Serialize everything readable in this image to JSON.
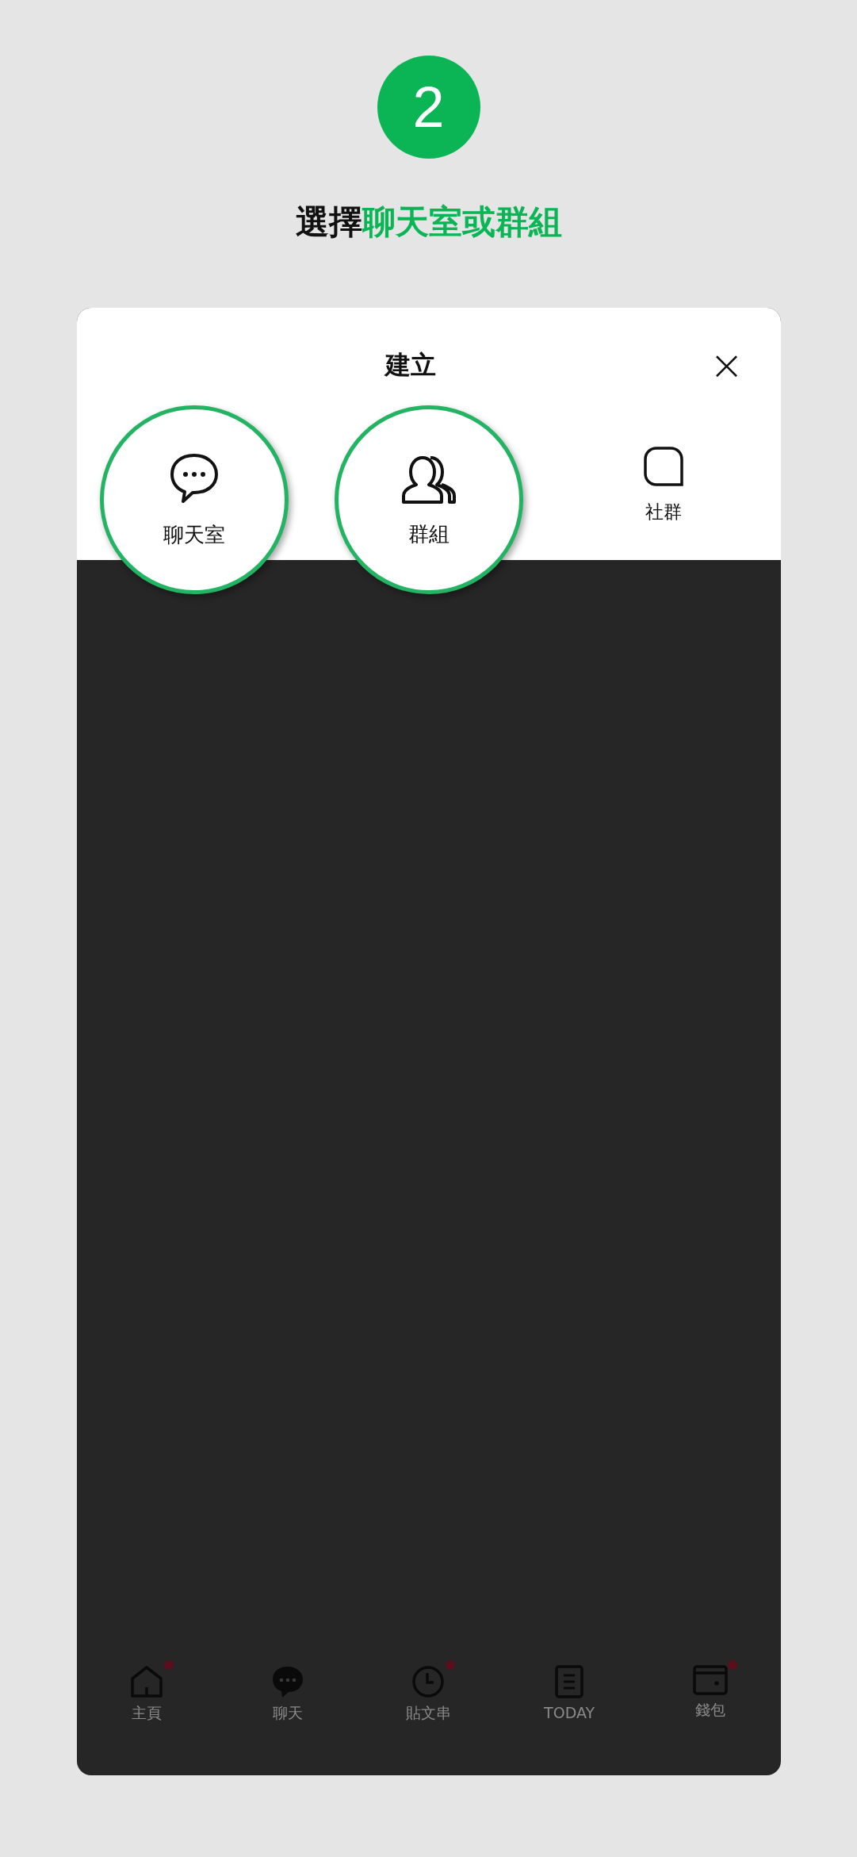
{
  "step": {
    "number": "2"
  },
  "heading": {
    "parts": [
      {
        "text": "選擇",
        "accent": false
      },
      {
        "text": "聊天室或群組",
        "accent": true
      }
    ]
  },
  "sheet": {
    "title": "建立",
    "close": "×",
    "options": [
      {
        "kind": "chat",
        "label": "聊天室",
        "highlighted": true
      },
      {
        "kind": "group",
        "label": "群組",
        "highlighted": true
      },
      {
        "kind": "community",
        "label": "社群",
        "highlighted": false
      }
    ]
  },
  "bottom_nav": [
    {
      "kind": "home",
      "label": "主頁",
      "badge": true
    },
    {
      "kind": "chat",
      "label": "聊天",
      "badge": false
    },
    {
      "kind": "posts",
      "label": "貼文串",
      "badge": true
    },
    {
      "kind": "today",
      "label": "TODAY",
      "badge": false
    },
    {
      "kind": "wallet",
      "label": "錢包",
      "badge": true
    }
  ]
}
